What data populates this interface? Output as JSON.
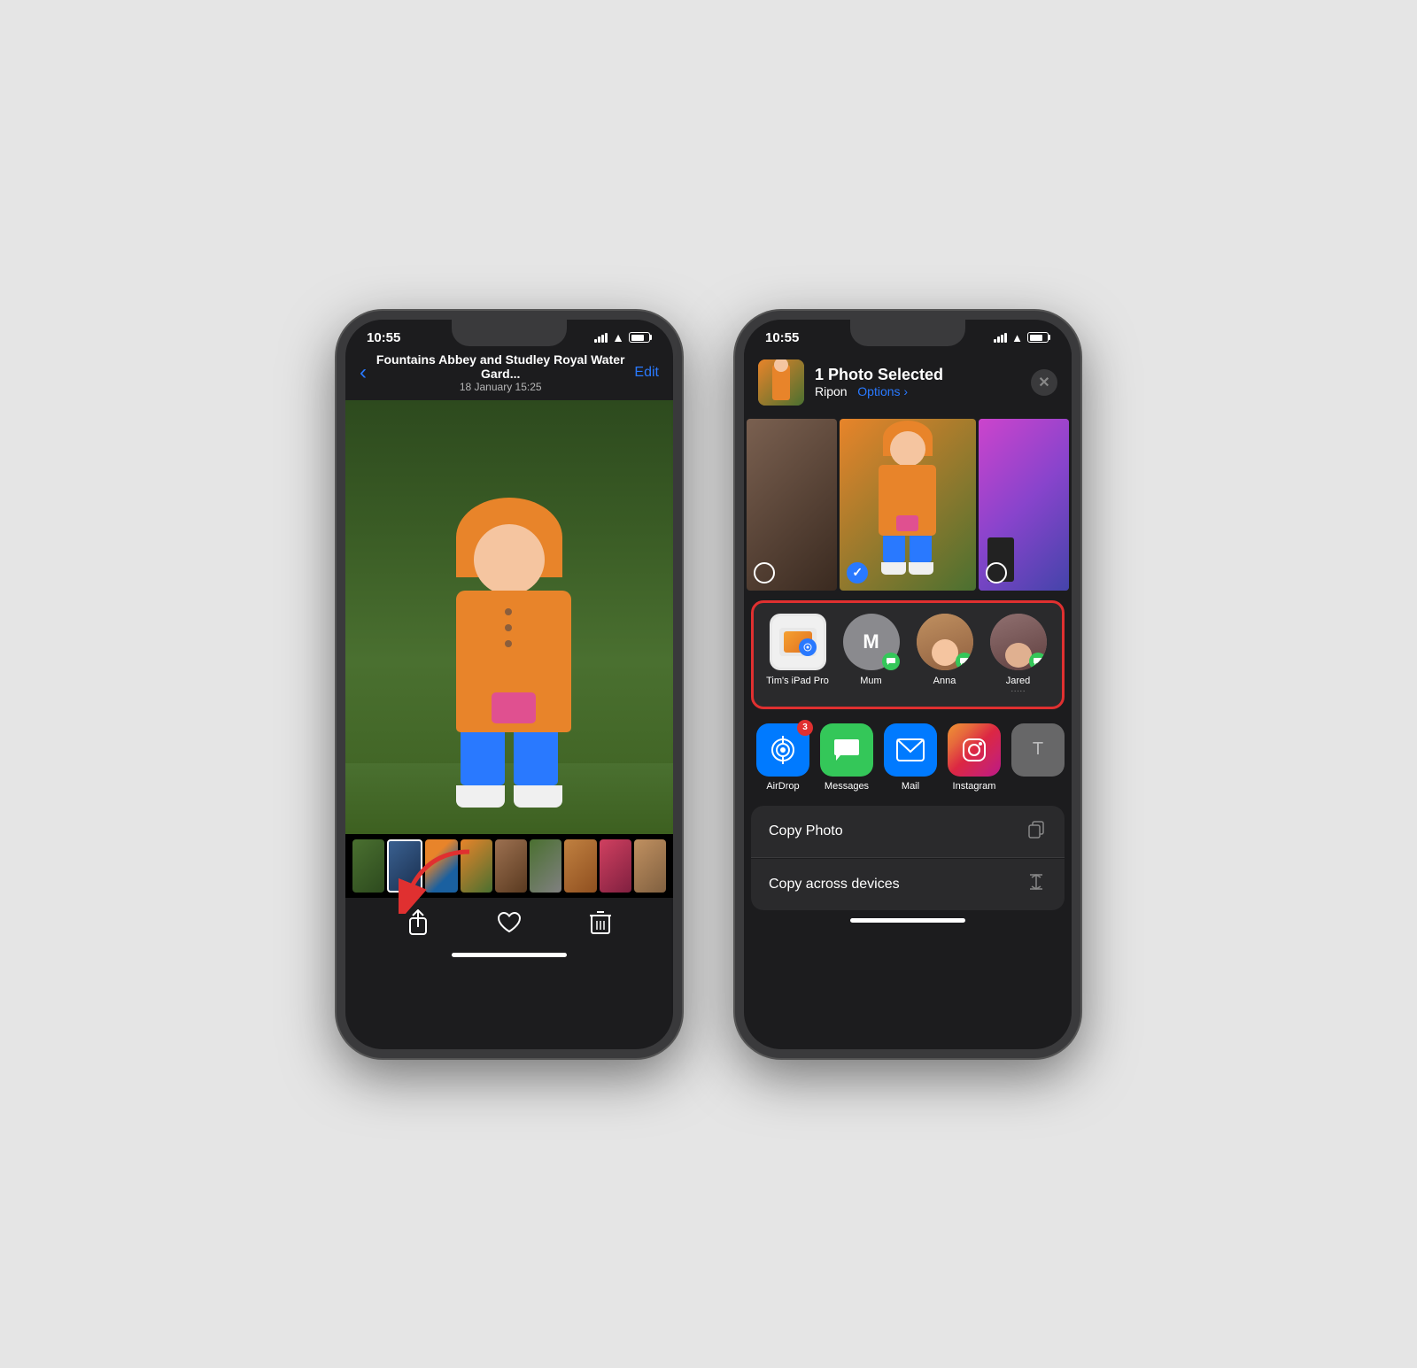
{
  "left_phone": {
    "status": {
      "time": "10:55",
      "signal": "●●●",
      "wifi": "wifi",
      "battery": "battery"
    },
    "nav": {
      "back_label": "‹",
      "title": "Fountains Abbey and Studley Royal Water Gard...",
      "subtitle": "18 January  15:25",
      "edit_label": "Edit"
    },
    "toolbar": {
      "share_label": "share",
      "heart_label": "heart",
      "trash_label": "trash"
    }
  },
  "right_phone": {
    "status": {
      "time": "10:55"
    },
    "share_header": {
      "title": "1 Photo Selected",
      "location": "Ripon",
      "options": "Options ›",
      "close": "✕"
    },
    "airdrop_section": {
      "contacts": [
        {
          "name": "Tim's iPad Pro",
          "sub": "",
          "type": "ipad"
        },
        {
          "name": "Mum",
          "sub": "",
          "type": "mum",
          "initial": "M"
        },
        {
          "name": "Anna",
          "sub": "",
          "type": "anna"
        },
        {
          "name": "Jared",
          "sub": "·····",
          "type": "jared"
        }
      ]
    },
    "app_row": {
      "apps": [
        {
          "name": "AirDrop",
          "type": "airdrop",
          "badge": "3"
        },
        {
          "name": "Messages",
          "type": "messages",
          "badge": null
        },
        {
          "name": "Mail",
          "type": "mail",
          "badge": null
        },
        {
          "name": "Instagram",
          "type": "instagram",
          "badge": null
        }
      ]
    },
    "actions": [
      {
        "label": "Copy Photo",
        "icon": "📋"
      },
      {
        "label": "Copy across devices",
        "icon": "✂"
      }
    ]
  }
}
